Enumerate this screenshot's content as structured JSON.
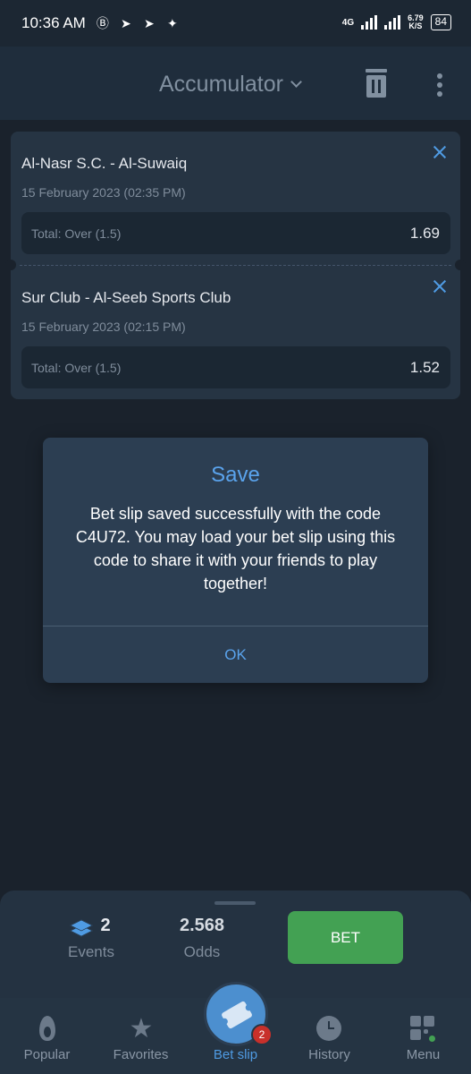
{
  "status_bar": {
    "time": "10:36 AM",
    "network": "4G",
    "speed_value": "6.79",
    "speed_unit": "K/S",
    "battery": "84"
  },
  "header": {
    "title": "Accumulator"
  },
  "bets": [
    {
      "teams": "Al-Nasr S.C. - Al-Suwaiq",
      "date": "15 February 2023 (02:35 PM)",
      "market": "Total: Over (1.5)",
      "odds": "1.69"
    },
    {
      "teams": "Sur Club - Al-Seeb Sports Club",
      "date": "15 February 2023 (02:15 PM)",
      "market": "Total: Over (1.5)",
      "odds": "1.52"
    }
  ],
  "dialog": {
    "title": "Save",
    "body": "Bet slip saved successfully with the code C4U72. You may load your bet slip using this code to share it with your friends to play together!",
    "ok_label": "OK"
  },
  "summary": {
    "events_count": "2",
    "events_label": "Events",
    "odds_value": "2.568",
    "odds_label": "Odds",
    "bet_label": "BET"
  },
  "nav": {
    "items": [
      {
        "label": "Popular",
        "icon": "fire-icon"
      },
      {
        "label": "Favorites",
        "icon": "star-icon"
      },
      {
        "label": "Bet slip",
        "icon": "ticket-icon"
      },
      {
        "label": "History",
        "icon": "clock-icon"
      },
      {
        "label": "Menu",
        "icon": "grid-icon"
      }
    ],
    "bet_slip_badge": "2"
  },
  "colors": {
    "accent": "#4f9be3",
    "bet_button": "#43a153",
    "badge": "#c8302b"
  }
}
